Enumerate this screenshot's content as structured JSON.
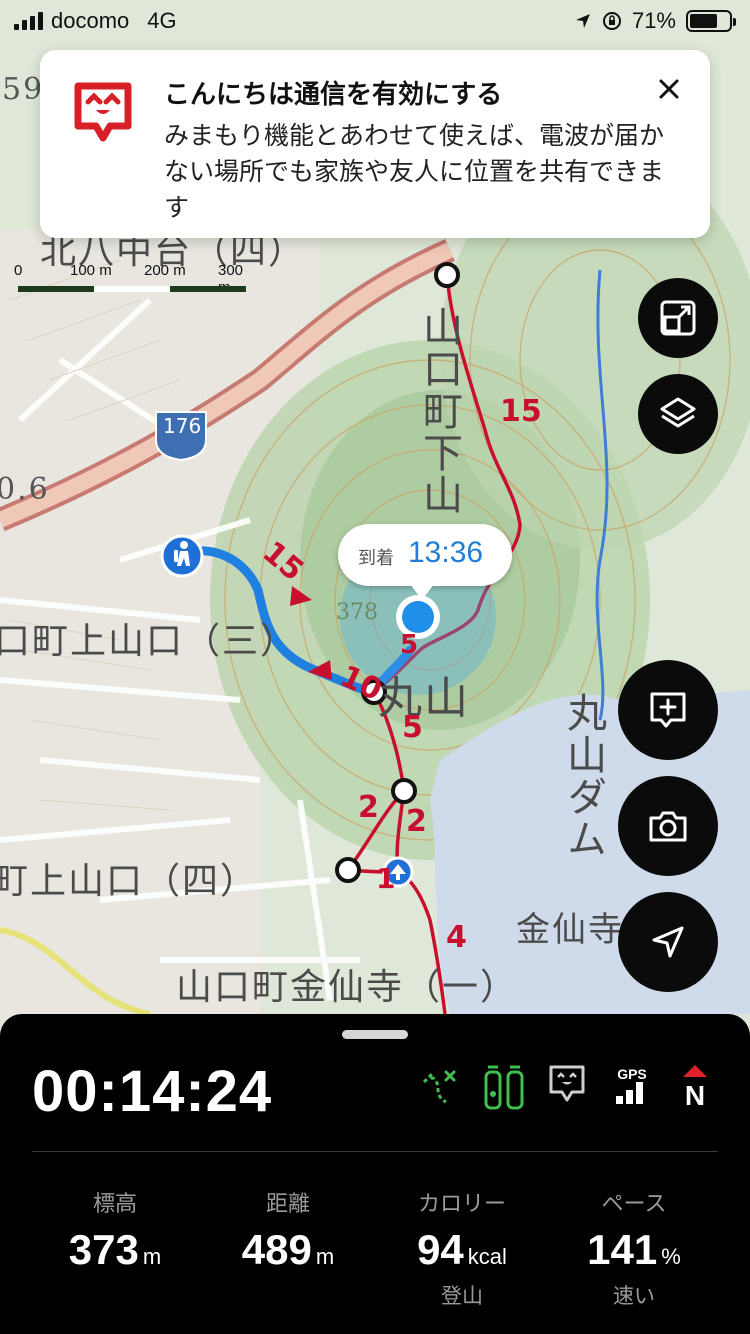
{
  "status_bar": {
    "carrier": "docomo",
    "network": "4G",
    "battery": "71%",
    "battery_level": 0.71
  },
  "notice": {
    "title": "こんにちは通信を有効にする",
    "body": "みまもり機能とあわせて使えば、電波が届かない場所でも家族や友人に位置を共有できます",
    "logo_icon": "kokonichiwa-logo-icon",
    "close_icon": "close-icon",
    "brand_color": "#d61f26"
  },
  "scale": {
    "labels": [
      "0",
      "100 m",
      "200 m",
      "300 m"
    ]
  },
  "map": {
    "labels": {
      "kita_yachu": "北八中台（四）",
      "road_number": "176",
      "elevation_left": "0.6",
      "elev_59": "59",
      "kamiyamaguchi": "口町上山口（三）",
      "shimoyama": "山口町下山",
      "maruyama": "丸山",
      "dam": "丸山ダム",
      "kamiyamaguchi4": "町上山口（四）",
      "kinsenji": "山口町金仙寺（一）",
      "kinsenji_small": "金仙寺",
      "peak": "378"
    },
    "route_markers": [
      "15",
      "15",
      "10",
      "5",
      "5",
      "2",
      "2",
      "1",
      "4"
    ],
    "route_color": "#c8102e",
    "track_color": "#1f80e0"
  },
  "arrival": {
    "label": "到着",
    "time": "13:36"
  },
  "map_buttons": {
    "fit_icon": "fit-route-icon",
    "layers_icon": "layers-icon",
    "add_memo_icon": "add-memo-icon",
    "camera_icon": "camera-icon",
    "navigate_icon": "navigation-arrow-icon"
  },
  "panel": {
    "timer": "00:14:24",
    "icons": [
      "route-off-icon",
      "track-pins-icon",
      "kokonichiwa-icon",
      "gps-signal-icon",
      "compass-north-icon"
    ],
    "gps_label": "GPS",
    "north_label": "N",
    "stats": [
      {
        "label": "標高",
        "value": "373",
        "unit": "m",
        "sub": ""
      },
      {
        "label": "距離",
        "value": "489",
        "unit": "m",
        "sub": ""
      },
      {
        "label": "カロリー",
        "value": "94",
        "unit": "kcal",
        "sub": "登山"
      },
      {
        "label": "ペース",
        "value": "141",
        "unit": "%",
        "sub": "速い"
      }
    ]
  }
}
